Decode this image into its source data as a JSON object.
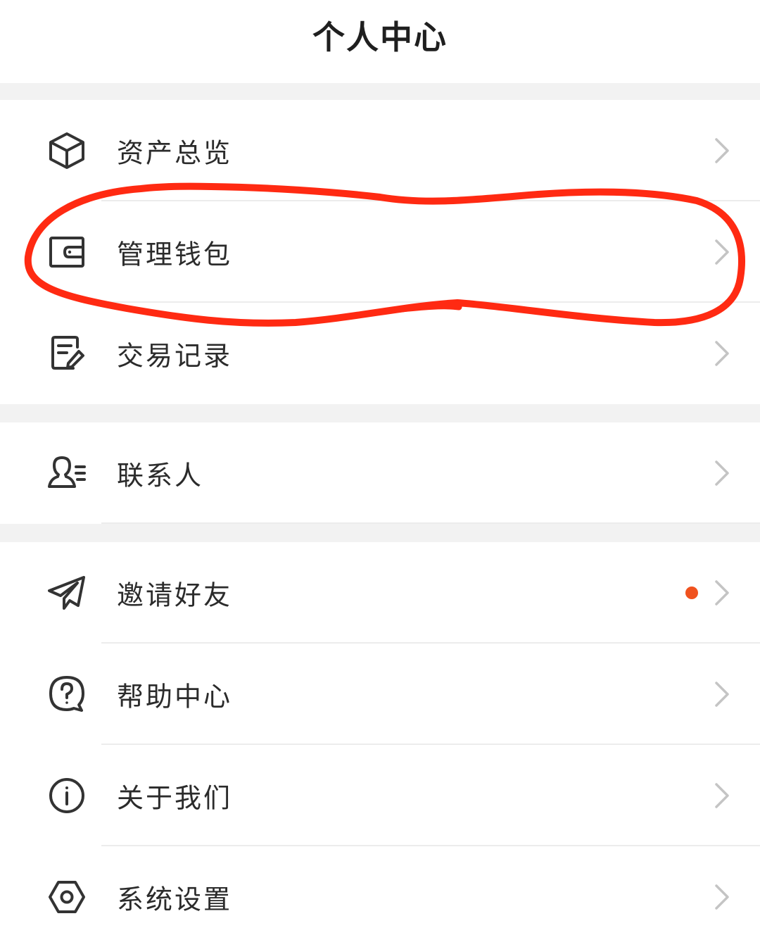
{
  "header": {
    "title": "个人中心"
  },
  "groups": [
    {
      "items": [
        {
          "label": "资产总览",
          "icon": "cube-icon"
        },
        {
          "label": "管理钱包",
          "icon": "wallet-icon"
        },
        {
          "label": "交易记录",
          "icon": "edit-document-icon"
        }
      ]
    },
    {
      "items": [
        {
          "label": "联系人",
          "icon": "contacts-icon"
        }
      ]
    },
    {
      "items": [
        {
          "label": "邀请好友",
          "icon": "paper-plane-icon",
          "badge": "dot"
        },
        {
          "label": "帮助中心",
          "icon": "help-question-icon"
        },
        {
          "label": "关于我们",
          "icon": "info-icon"
        },
        {
          "label": "系统设置",
          "icon": "hexagon-settings-icon"
        }
      ]
    }
  ],
  "colors": {
    "background": "#ffffff",
    "group_gap": "#f2f2f2",
    "text": "#2b2b2b",
    "icon_stroke": "#333333",
    "chevron": "#c4c4c4",
    "badge_dot": "#f0521e",
    "annotation_circle": "#ff2a12"
  },
  "annotation": {
    "type": "hand-drawn-circle",
    "highlights": "管理钱包"
  }
}
